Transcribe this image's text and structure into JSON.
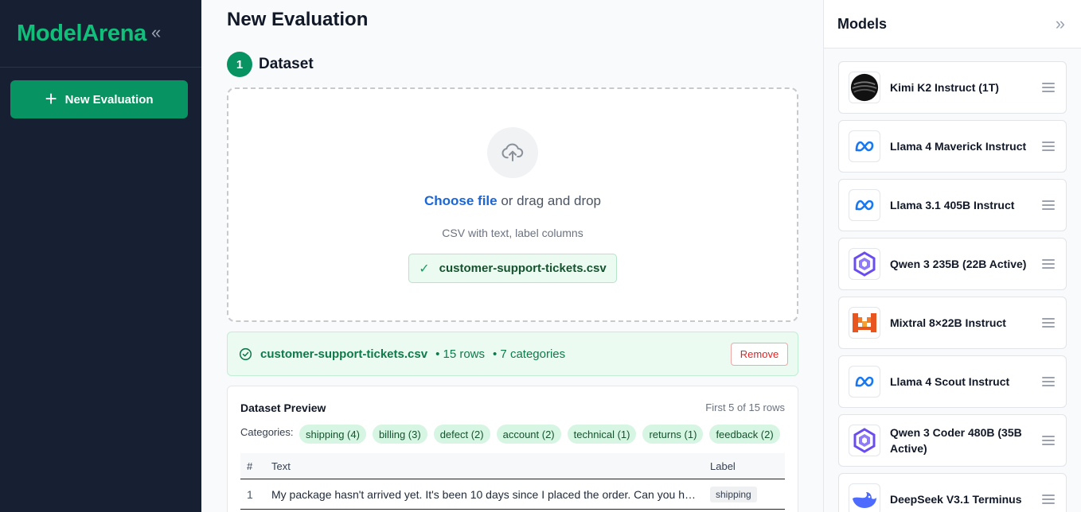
{
  "sidebar": {
    "brand": "ModelArena",
    "collapse_icon": "«",
    "new_eval_label": "New Evaluation"
  },
  "main": {
    "title": "New Evaluation",
    "step": {
      "number": "1",
      "title": "Dataset"
    },
    "dropzone": {
      "choose_link": "Choose file",
      "choose_rest": " or drag and drop",
      "hint": "CSV with text, label columns",
      "selected_file": "customer-support-tickets.csv"
    },
    "loaded": {
      "file": "customer-support-tickets.csv",
      "rows": "• 15 rows",
      "categories": "• 7 categories",
      "remove_label": "Remove"
    },
    "preview": {
      "title": "Dataset Preview",
      "count": "First 5 of 15 rows",
      "categories_label": "Categories:",
      "categories": [
        "shipping (4)",
        "billing (3)",
        "defect (2)",
        "account (2)",
        "technical (1)",
        "returns (1)",
        "feedback (2)"
      ],
      "headers": {
        "num": "#",
        "text": "Text",
        "label": "Label"
      },
      "rows": [
        {
          "num": "1",
          "text": "My package hasn't arrived yet. It's been 10 days since I placed the order. Can you help me track it?",
          "label": "shipping"
        }
      ]
    }
  },
  "models": {
    "title": "Models",
    "collapse_icon": "»",
    "items": [
      {
        "name": "Kimi K2 Instruct (1T)",
        "logo": "kimi-logo"
      },
      {
        "name": "Llama 4 Maverick Instruct",
        "logo": "meta-logo"
      },
      {
        "name": "Llama 3.1 405B Instruct",
        "logo": "meta-logo"
      },
      {
        "name": "Qwen 3 235B (22B Active)",
        "logo": "qwen-logo"
      },
      {
        "name": "Mixtral 8×22B Instruct",
        "logo": "mistral-logo"
      },
      {
        "name": "Llama 4 Scout Instruct",
        "logo": "meta-logo"
      },
      {
        "name": "Qwen 3 Coder 480B (35B Active)",
        "logo": "qwen-logo"
      },
      {
        "name": "DeepSeek V3.1 Terminus",
        "logo": "deepseek-logo"
      }
    ]
  },
  "colors": {
    "brand": "#10c07a",
    "primary": "#079462",
    "link": "#1a66d6",
    "danger": "#dc2626"
  }
}
